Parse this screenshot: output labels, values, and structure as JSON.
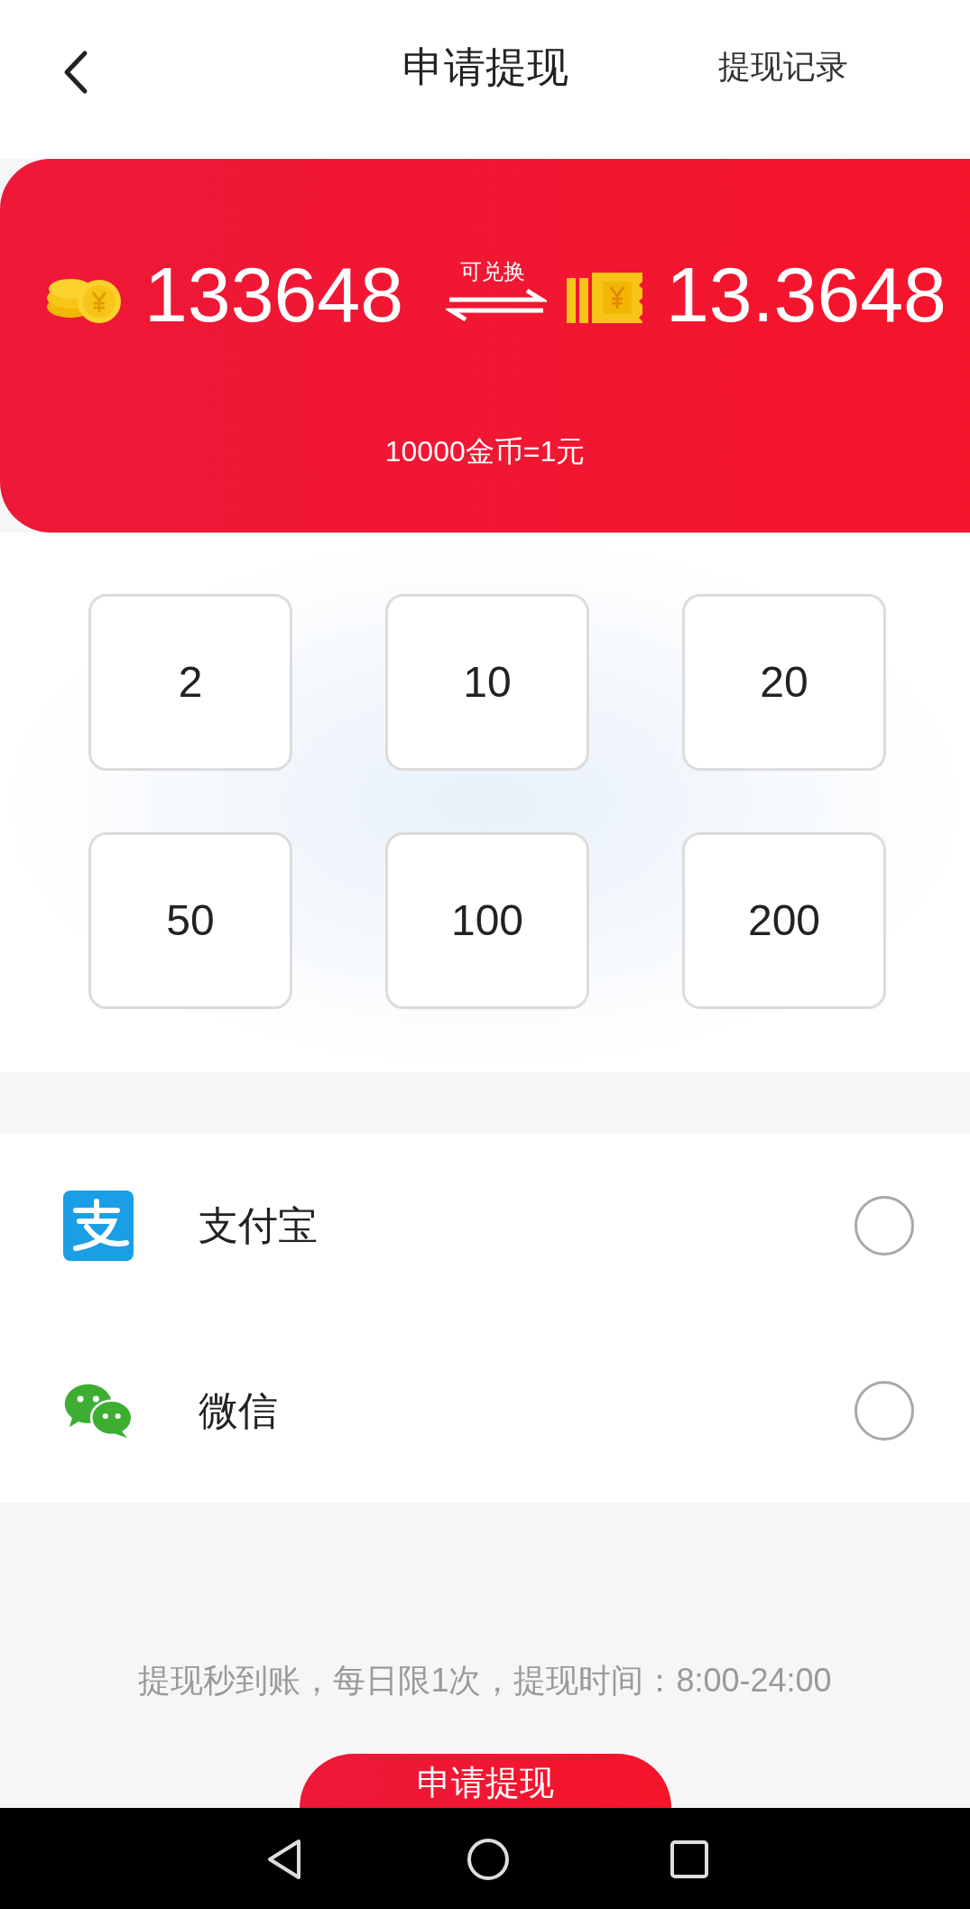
{
  "header": {
    "title": "申请提现",
    "action": "提现记录"
  },
  "balance": {
    "coins": "133648",
    "exchange_label": "可兑换",
    "cash": "13.3648",
    "rate": "10000金币=1元"
  },
  "amounts": [
    {
      "label": "2",
      "selected": false
    },
    {
      "label": "10",
      "selected": false
    },
    {
      "label": "20",
      "selected": false
    },
    {
      "label": "50",
      "selected": false
    },
    {
      "label": "100",
      "selected": false
    },
    {
      "label": "200",
      "selected": false
    }
  ],
  "payment_methods": [
    {
      "kind": "alipay",
      "label": "支付宝",
      "selected": false
    },
    {
      "kind": "wechat",
      "label": "微信",
      "selected": false
    }
  ],
  "note": "提现秒到账，每日限1次，提现时间：8:00-24:00",
  "submit": {
    "label": "申请提现"
  }
}
